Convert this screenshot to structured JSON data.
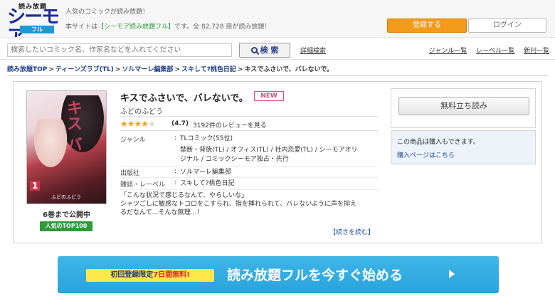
{
  "header": {
    "logo_top": "読み放題",
    "logo_main": "シーモア",
    "logo_badge": "フル",
    "tagline": "人気のコミックが読み放題！",
    "subline_prefix": "本サイトは",
    "subline_accent": "【シーモア読み放題フル】",
    "subline_suffix": "です。全 82,728 冊が読み放題！",
    "register_label": "登録する",
    "login_label": "ログイン"
  },
  "search": {
    "placeholder": "検索したいコミック名、作家名などを入れてください",
    "button_label": "検 索",
    "advanced_label": "詳細検索",
    "nav": [
      "ジャンル一覧",
      "レーベル一覧",
      "新刊一覧"
    ]
  },
  "breadcrumb": {
    "items": [
      "読み放題TOP",
      "ティーンズラブ(TL)",
      "ソルマーレ編集部",
      "スキして?桃色日記"
    ],
    "current": "キスでふさいで、バレないで。",
    "separator": ">"
  },
  "product": {
    "title": "キスでふさいで、バレないで。",
    "new_badge": "NEW",
    "author": "ふどのふどう",
    "rating": 4.7,
    "rating_text": "(4.7)",
    "stars_full": "★★★★",
    "stars_half": "★",
    "review_text": "3192件のレビューを見る",
    "volumes_text": "6巻まで公開中",
    "top100_badge": "人気のTOP100",
    "cover_title": "キス バ",
    "cover_num": "1",
    "cover_author": "ふどのふどう",
    "meta": {
      "genre_label": "ジャンル",
      "genre_value": "TLコミック(55位)",
      "genre_tags_1": "禁断・背徳(TL) / オフィス(TL) / 社内恋愛(TL) / シーモアオリ",
      "genre_tags_2": "ジナル / コミックシーモア独占・先行",
      "publisher_label": "出版社",
      "publisher_value": "ソルマーレ編集部",
      "label_label": "雑誌・レーベル",
      "label_value": "スキして?桃色日記",
      "colon": ":"
    },
    "description_1": "「こんな状況で感じるなんて、やらしいな」",
    "description_2": "シャツごしに敏感なトコロをこすられ、指を挿れられて、バレないように声を抑え",
    "description_3": "るだなんて…そんな無理…！",
    "read_more": "【続きを読む】",
    "trial_label": "無料立ち読み",
    "buy_note": "この商品は購入もできます。",
    "buy_link": "購入ページはこちら"
  },
  "banner": {
    "tag_prefix": "初回登録限定",
    "tag_red": "7日間無料!",
    "text": "読み放題フルを今すぐ始める"
  },
  "colors": {
    "accent_orange": "#f49a1a",
    "brand_blue": "#1b2a9a",
    "badge_green": "#2f9a3a",
    "banner_blue": "#2aa2dc",
    "new_pink": "#e04a7a"
  }
}
